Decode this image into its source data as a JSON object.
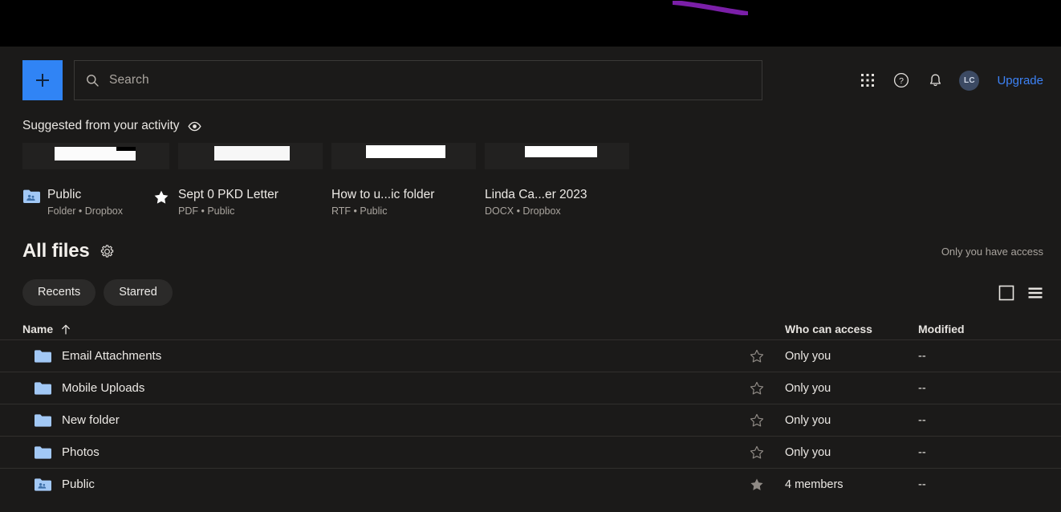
{
  "header": {
    "new_button_label": "+",
    "search_placeholder": "Search",
    "apps_icon": "grid-apps-icon",
    "help_icon": "help-circle-icon",
    "notifications_icon": "bell-icon",
    "avatar_initials": "LC",
    "upgrade_label": "Upgrade",
    "accent_blue": "#3084f5",
    "link_blue": "#3d82f5"
  },
  "suggested": {
    "title": "Suggested from your activity",
    "eye_icon": "eye-icon",
    "cards": [
      {
        "name": "Public",
        "meta": "Folder • Dropbox",
        "icon": "shared-folder-icon",
        "starred": true
      },
      {
        "name": "Sept 0 PKD Letter",
        "meta": "PDF • Public",
        "icon": "",
        "starred": false
      },
      {
        "name": "How to u...ic folder",
        "meta": "RTF • Public",
        "icon": "",
        "starred": false
      },
      {
        "name": "Linda Ca...er 2023",
        "meta": "DOCX • Dropbox",
        "icon": "",
        "starred": false
      }
    ]
  },
  "all_files": {
    "title": "All files",
    "gear_icon": "gear-icon",
    "access_note": "Only you have access",
    "chips": [
      "Recents",
      "Starred"
    ],
    "view_grid_icon": "grid-view-icon",
    "view_list_icon": "list-view-icon",
    "columns": {
      "name": "Name",
      "sort_icon": "arrow-up-icon",
      "who_can_access": "Who can access",
      "modified": "Modified"
    },
    "rows": [
      {
        "name": "Email Attachments",
        "icon": "folder-icon",
        "starred": false,
        "access": "Only you",
        "modified": "--"
      },
      {
        "name": "Mobile Uploads",
        "icon": "folder-icon",
        "starred": false,
        "access": "Only you",
        "modified": "--"
      },
      {
        "name": "New folder",
        "icon": "folder-icon",
        "starred": false,
        "access": "Only you",
        "modified": "--"
      },
      {
        "name": "Photos",
        "icon": "folder-icon",
        "starred": false,
        "access": "Only you",
        "modified": "--"
      },
      {
        "name": "Public",
        "icon": "shared-folder-icon",
        "starred": true,
        "access": "4 members",
        "modified": "--"
      }
    ]
  },
  "annotation": {
    "stroke_color": "#7b1fa8",
    "shape": "purple-diagonal-stroke"
  }
}
